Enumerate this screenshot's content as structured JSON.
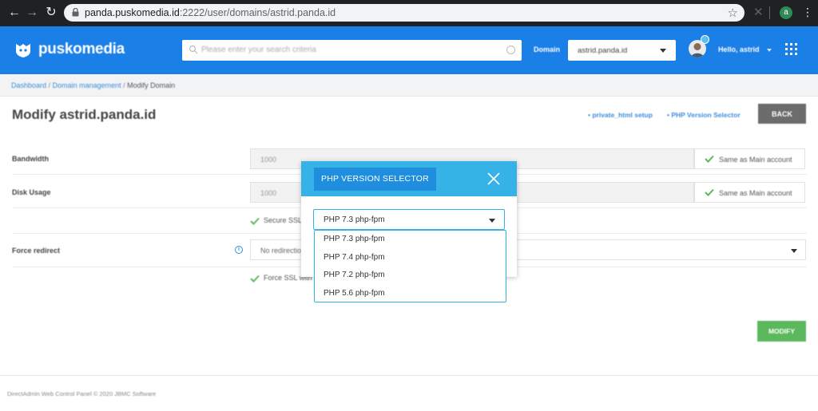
{
  "browser": {
    "url_host": "panda.puskomedia.id",
    "url_rest": ":2222/user/domains/astrid.panda.id",
    "profile_letter": "a"
  },
  "header": {
    "logo_text": "puskomedia",
    "search_placeholder": "Please enter your search criteria",
    "domain_label": "Domain",
    "domain_value": "astrid.panda.id",
    "notification_count": "1",
    "greeting": "Hello, astrid"
  },
  "breadcrumb": {
    "items": [
      "Dashboard",
      "Domain management",
      "Modify Domain"
    ],
    "separator": "/"
  },
  "page": {
    "title": "Modify astrid.panda.id",
    "links": [
      "• private_html setup",
      "• PHP Version Selector"
    ],
    "back_label": "BACK"
  },
  "form": {
    "bandwidth_label": "Bandwidth",
    "bandwidth_value": "1000",
    "disk_label": "Disk Usage",
    "disk_value": "1000",
    "same_label": "Same as Main account",
    "secure_ssl": "Secure SSL",
    "force_redirect_label": "Force redirect",
    "redirect_value": "No redirectio",
    "force_ssl": "Force SSL with",
    "modify_label": "MODIFY"
  },
  "modal": {
    "title": "PHP VERSION SELECTOR",
    "selected": "PHP 7.3 php-fpm",
    "options": [
      "PHP 7.3 php-fpm",
      "PHP 7.4 php-fpm",
      "PHP 7.2 php-fpm",
      "PHP 5.6 php-fpm"
    ]
  },
  "footer": {
    "text": "DirectAdmin Web Control Panel © 2020 JBMC Software"
  },
  "colors": {
    "brand": "#1a7fe6",
    "modal_header": "#36b3e6",
    "modal_title_bg": "#1f8ede",
    "success": "#5cb85c",
    "link": "#3e8fd8"
  }
}
